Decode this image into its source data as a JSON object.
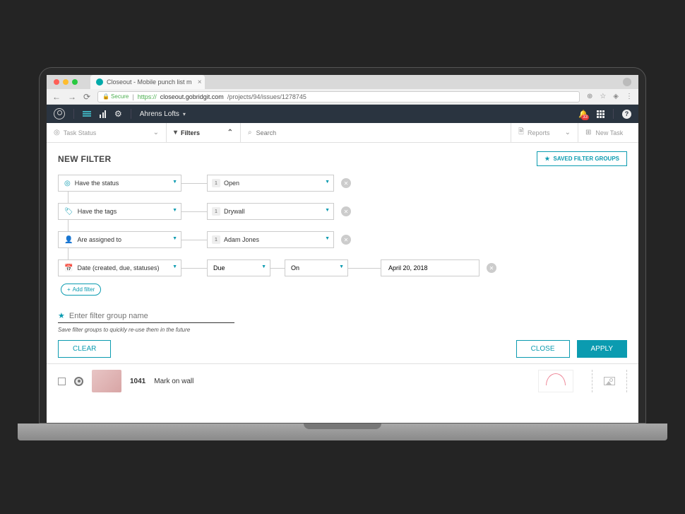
{
  "browser": {
    "tab_title": "Closeout - Mobile punch list m",
    "secure_label": "Secure",
    "url_proto": "https://",
    "url_domain": "closeout.gobridgit.com",
    "url_path": "/projects/94/issues/1278745"
  },
  "header": {
    "project_name": "Ahrens Lofts",
    "badge_count": "33"
  },
  "toolbar": {
    "task_status": "Task Status",
    "filters": "Filters",
    "search_placeholder": "Search",
    "reports": "Reports",
    "new_task": "New Task"
  },
  "filter": {
    "title": "NEW FILTER",
    "saved_groups": "SAVED FILTER GROUPS",
    "rows": {
      "status_label": "Have the status",
      "status_value": "Open",
      "tags_label": "Have the tags",
      "tags_value": "Drywall",
      "assigned_label": "Are assigned to",
      "assigned_value": "Adam Jones",
      "date_label": "Date (created, due, statuses)",
      "date_type": "Due",
      "date_op": "On",
      "date_value": "April 20, 2018",
      "count1": "1"
    },
    "add_filter": "Add filter",
    "group_placeholder": "Enter filter group name",
    "hint": "Save filter groups to quickly re-use them in the future",
    "clear": "CLEAR",
    "close": "CLOSE",
    "apply": "APPLY"
  },
  "task": {
    "id": "1041",
    "title": "Mark on wall"
  }
}
